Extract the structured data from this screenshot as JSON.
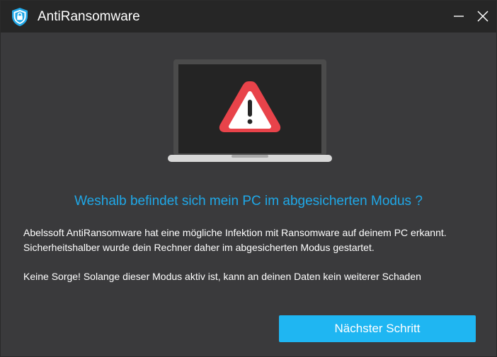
{
  "window": {
    "title": "AntiRansomware",
    "controls": {
      "minimize_icon": "minimize-icon",
      "close_icon": "close-icon"
    }
  },
  "main": {
    "headline": "Weshalb befindet sich mein PC im abgesicherten Modus ?",
    "paragraph_1_line_1": "Abelssoft AntiRansomware hat eine mögliche Infektion mit Ransomware auf deinem PC erkannt.",
    "paragraph_1_line_2": "Sicherheitshalber wurde dein Rechner daher im abgesicherten Modus gestartet.",
    "paragraph_2": "Keine Sorge! Solange dieser Modus aktiv ist, kann an deinen Daten kein weiterer Schaden",
    "next_button_label": "Nächster Schritt"
  },
  "colors": {
    "titlebar": "#262626",
    "background": "#3a3a3c",
    "accent": "#1fb6f2",
    "headline": "#1fa8e8",
    "warning": "#e8434a"
  }
}
